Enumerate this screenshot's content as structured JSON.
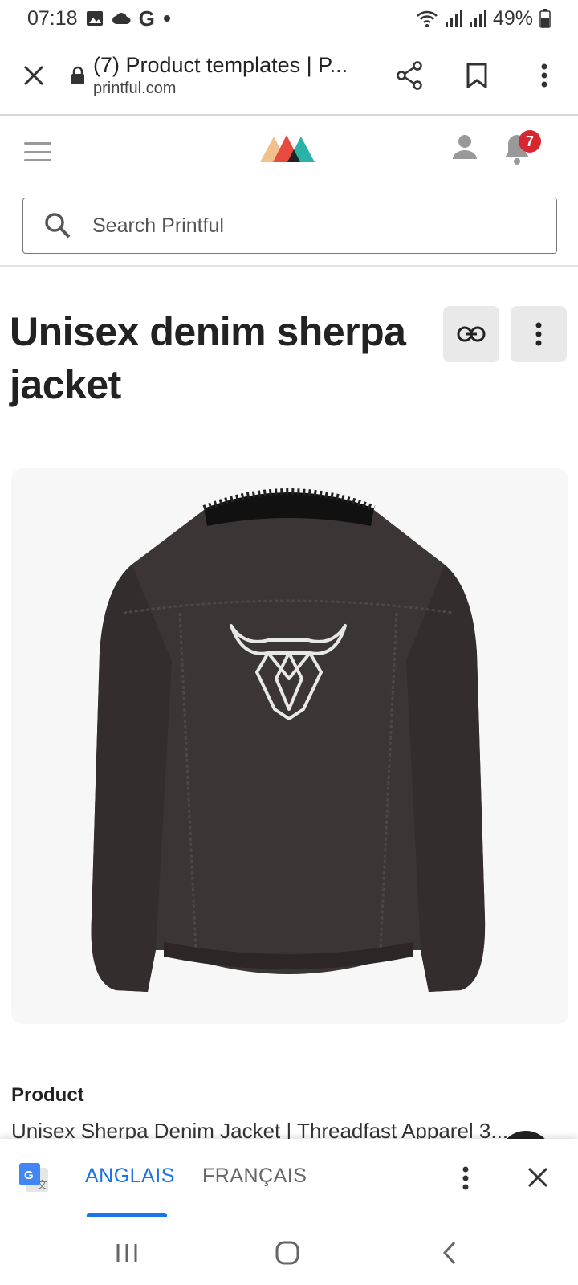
{
  "status_bar": {
    "time": "07:18",
    "battery": "49%"
  },
  "browser": {
    "tab_title": "(7) Product templates | P...",
    "domain": "printful.com"
  },
  "header": {
    "notification_count": "7"
  },
  "search": {
    "placeholder": "Search Printful"
  },
  "product": {
    "title": "Unisex denim sherpa jacket",
    "section_label": "Product",
    "description": "Unisex Sherpa Denim Jacket | Threadfast Apparel 3..."
  },
  "translate_bar": {
    "source_lang": "ANGLAIS",
    "target_lang": "FRANÇAIS"
  },
  "icons": [
    "gallery-icon",
    "cloud-icon",
    "google-icon",
    "wifi-icon",
    "signal-icon",
    "battery-icon",
    "close-icon",
    "lock-icon",
    "share-icon",
    "bookmark-icon",
    "more-vert-icon",
    "hamburger-icon",
    "user-icon",
    "bell-icon",
    "search-icon",
    "link-icon",
    "google-translate-icon",
    "recents-icon",
    "home-icon",
    "back-icon"
  ],
  "colors": {
    "accent_blue": "#1a73e8",
    "badge_red": "#d6262f",
    "logo_orange": "#f2c08a",
    "logo_red": "#e84a3f",
    "logo_teal": "#2ab3a6"
  }
}
